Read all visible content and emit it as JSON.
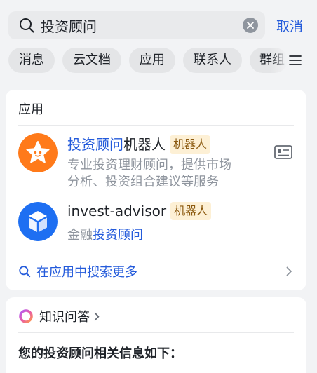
{
  "search": {
    "value": "投资顾问",
    "cancel_label": "取消"
  },
  "chips": [
    "消息",
    "云文档",
    "应用",
    "联系人",
    "群组"
  ],
  "apps_section": {
    "title": "应用",
    "items": [
      {
        "name_highlight": "投资顾问",
        "name_rest": "机器人",
        "badge": "机器人",
        "desc_line1": "专业投资理财顾问，提供市场",
        "desc_line2": "分析、投资组合建议等服务"
      },
      {
        "name_highlight": "",
        "name_rest": "invest-advisor",
        "badge": "机器人",
        "desc_prefix": "金融",
        "desc_highlight": "投资顾问"
      }
    ],
    "more_label": "在应用中搜索更多"
  },
  "qa_section": {
    "title": "知识问答",
    "answer": "您的投资顾问相关信息如下："
  },
  "colors": {
    "accent": "#245bdb",
    "badge_bg": "#fdf0d5",
    "badge_text": "#8c5a10",
    "app1_icon": "#ff7a1a",
    "app2_icon": "#1e6ff2"
  },
  "icons": {
    "search": "search-icon",
    "clear": "clear-icon",
    "menu": "menu-icon",
    "app1": "star-face-icon",
    "app2": "cube-icon",
    "card": "contact-card-icon",
    "more_search": "search-icon",
    "chevron": "chevron-right-icon",
    "qa": "ring-logo-icon"
  }
}
